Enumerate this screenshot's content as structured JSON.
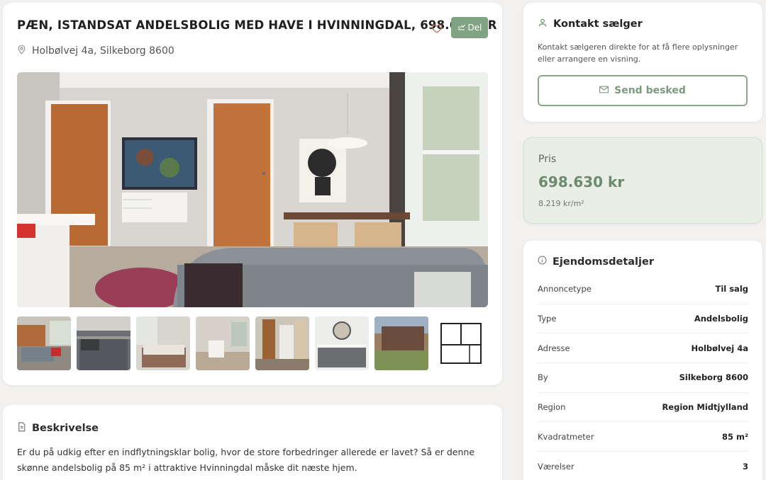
{
  "listing": {
    "title": "PÆN, ISTANDSAT ANDELSBOLIG MED HAVE I HVINNINGDAL, 698.630 KR",
    "share_label": "Del",
    "address": "Holbølvej 4a, Silkeborg 8600"
  },
  "icons": {
    "heart": "heart-icon",
    "share": "share-icon",
    "location": "location-pin-icon",
    "user": "user-icon",
    "mail": "mail-icon",
    "info": "info-icon",
    "document": "document-icon"
  },
  "colors": {
    "accent": "#7fa383",
    "price_bg": "#e9eee7",
    "price_text": "#6b8a6e"
  },
  "contact": {
    "title": "Kontakt sælger",
    "text": "Kontakt sælgeren direkte for at få flere oplysninger eller arrangere en visning.",
    "button": "Send besked"
  },
  "price": {
    "label": "Pris",
    "value": "698.630 kr",
    "per_sqm": "8.219 kr/m²"
  },
  "details": {
    "title": "Ejendomsdetaljer",
    "rows": [
      {
        "key": "Annoncetype",
        "value": "Til salg"
      },
      {
        "key": "Type",
        "value": "Andelsbolig"
      },
      {
        "key": "Adresse",
        "value": "Holbølvej 4a"
      },
      {
        "key": "By",
        "value": "Silkeborg 8600"
      },
      {
        "key": "Region",
        "value": "Region Midtjylland"
      },
      {
        "key": "Kvadratmeter",
        "value": "85 m²"
      },
      {
        "key": "Værelser",
        "value": "3"
      }
    ]
  },
  "description": {
    "title": "Beskrivelse",
    "text": "Er du på udkig efter en indflytningsklar bolig, hvor de store forbedringer allerede er lavet? Så er denne skønne andelsbolig på 85 m² i attraktive Hvinningdal måske dit næste hjem."
  }
}
